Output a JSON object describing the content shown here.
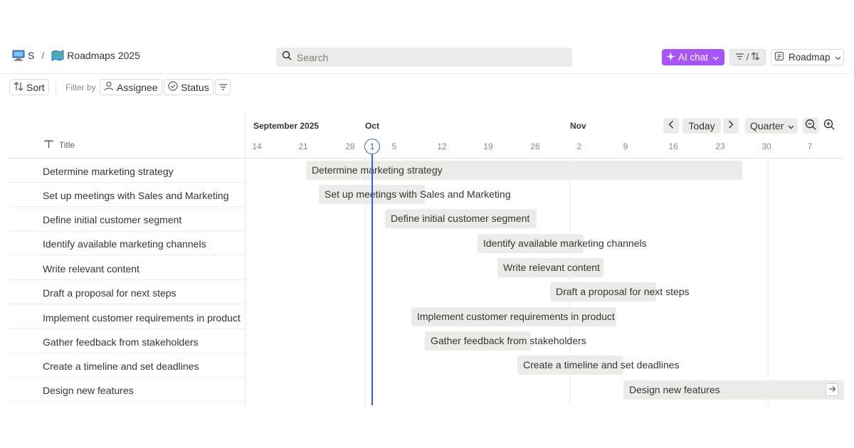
{
  "breadcrumb": {
    "workspace": "S",
    "separator": "/",
    "page": "Roadmaps 2025"
  },
  "search": {
    "placeholder": "Search"
  },
  "header": {
    "ai_chat_label": "AI chat",
    "filter_sort_separator": "/",
    "view_label": "Roadmap"
  },
  "toolbar": {
    "sort_label": "Sort",
    "filter_by_label": "Filter by",
    "assignee_label": "Assignee",
    "status_label": "Status"
  },
  "table": {
    "title_header": "Title",
    "rows": [
      "Determine marketing strategy",
      "Set up meetings with Sales and Marketing",
      "Define initial customer segment",
      "Identify available marketing channels",
      "Write relevant content",
      "Draft a proposal for next steps",
      "Implement customer requirements in product",
      "Gather feedback from stakeholders",
      "Create a timeline and set deadlines",
      "Design new features"
    ]
  },
  "timeline": {
    "months": [
      "September 2025",
      "Oct",
      "Nov"
    ],
    "ticks": [
      "14",
      "21",
      "28",
      "1",
      "5",
      "12",
      "19",
      "26",
      "2",
      "9",
      "16",
      "23",
      "30",
      "7"
    ],
    "today_tick": "1",
    "today_button": "Today",
    "range_label": "Quarter",
    "bars": [
      "Determine marketing strategy",
      "Set up meetings with Sales and Marketing",
      "Define initial customer segment",
      "Identify available marketing channels",
      "Write relevant content",
      "Draft a proposal for next steps",
      "Implement customer requirements in product",
      "Gather feedback from stakeholders",
      "Create a timeline and set deadlines",
      "Design new features"
    ]
  },
  "colors": {
    "accent": "#a855f7",
    "today_line": "#3b5bdb",
    "bar_fill": "#ebebea"
  },
  "icons": [
    "computer-icon",
    "map-icon",
    "search-icon",
    "sparkle-icon",
    "chevron-down-icon",
    "filter-icon",
    "sort-icon",
    "document-icon",
    "person-icon",
    "check-circle-icon",
    "text-icon",
    "chevron-left-icon",
    "chevron-right-icon",
    "zoom-out-icon",
    "zoom-in-icon",
    "arrow-right-icon"
  ]
}
